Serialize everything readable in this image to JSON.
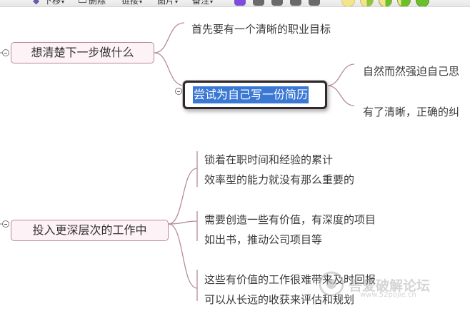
{
  "toolbar": {
    "items": [
      "下移",
      "删除",
      "链接",
      "图片",
      "备注"
    ],
    "priority_icon_names": [
      "priority-3-icon",
      "priority-6-icon",
      "priority-7-icon",
      "priority-8-icon",
      "priority-9-icon"
    ],
    "progress_icon_names": [
      "progress-0-icon",
      "progress-25-icon",
      "progress-50-icon",
      "progress-75-icon",
      "progress-done-icon"
    ],
    "priority_colors": [
      "#7d4fd9",
      "#6a6a6a"
    ],
    "progress_colors": [
      "#f3e58a",
      "#6bbf2a"
    ]
  },
  "mindmap": {
    "accent_color": "#b78aa0",
    "selection_color": "#3a78d4",
    "branch1": {
      "label": "想清楚下一步做什么",
      "leaf1": "首先要有一个清晰的职业目标",
      "selected_topic": "尝试为自己写一份简历",
      "sub_leaf1": "自然而然强迫自己思",
      "sub_leaf2": "有了清晰，正确的纠"
    },
    "branch2": {
      "label": "投入更深层次的工作中",
      "leaf1_line1": "锁着在职时间和经验的累计",
      "leaf1_line2": "效率型的能力就没有那么重要的",
      "leaf2_line1": "需要创造一些有价值，有深度的项目",
      "leaf2_line2": "如出书，推动公司项目等",
      "leaf3_line1": "这些有价值的工作很难带来及时回报",
      "leaf3_line2": "可以从长远的收获来评估和规划"
    }
  },
  "watermark": {
    "text": "吾爱破解论坛",
    "url": "www.52pojie.cn"
  }
}
